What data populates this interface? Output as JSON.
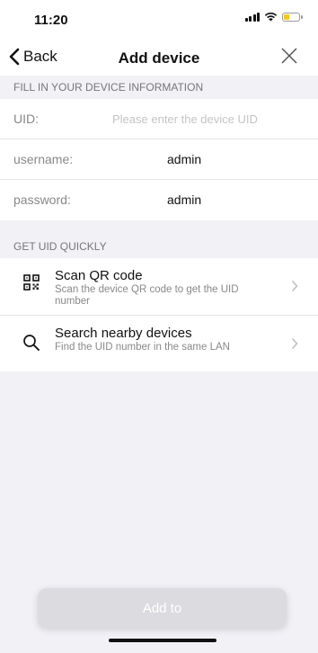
{
  "status_bar": {
    "time": "11:20",
    "battery_color": "#f3c81a"
  },
  "nav": {
    "back_label": "Back",
    "title": "Add device",
    "close_icon": "close-icon"
  },
  "form_section": {
    "header": "FILL IN YOUR DEVICE INFORMATION"
  },
  "form": {
    "uid_label": "UID:",
    "uid_placeholder": "Please enter the device UID",
    "uid_value": "",
    "username_label": "username:",
    "username_value": "admin",
    "password_label": "password:",
    "password_value": "admin"
  },
  "quick_section": {
    "header": "GET UID QUICKLY"
  },
  "options": [
    {
      "icon": "qr-code-icon",
      "title": "Scan QR code",
      "description": "Scan the device QR code to get the UID number"
    },
    {
      "icon": "search-icon",
      "title": "Search nearby devices",
      "description": "Find the UID number in the same LAN"
    }
  ],
  "add_button": {
    "label": "Add to",
    "background": "#dcdce0"
  }
}
